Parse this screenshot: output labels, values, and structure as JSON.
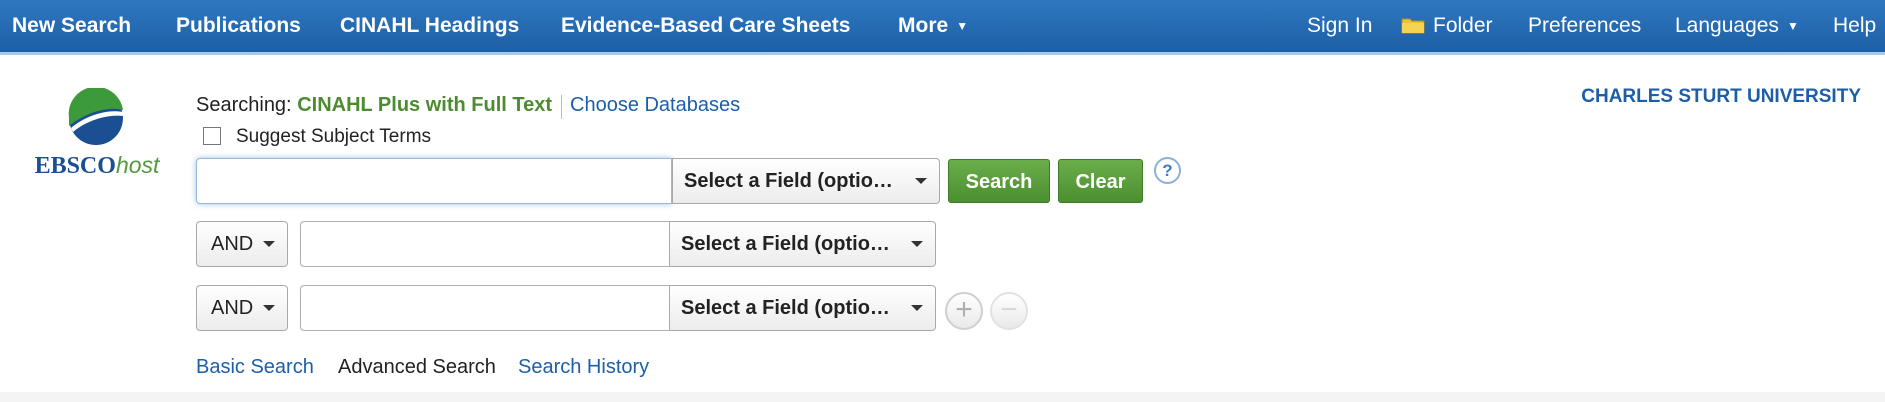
{
  "nav": {
    "new_search": "New Search",
    "publications": "Publications",
    "cinahl_headings": "CINAHL Headings",
    "care_sheets": "Evidence-Based Care Sheets",
    "more": "More",
    "sign_in": "Sign In",
    "folder": "Folder",
    "preferences": "Preferences",
    "languages": "Languages",
    "help": "Help"
  },
  "logo": {
    "ebsco": "EBSCO",
    "host": "host"
  },
  "searching": {
    "label": "Searching:",
    "database": "CINAHL Plus with Full Text",
    "choose_databases": "Choose Databases"
  },
  "suggest_subject_terms": {
    "label": "Suggest Subject Terms",
    "checked": false
  },
  "search_rows": [
    {
      "operator": "",
      "value": "",
      "field": "Select a Field (optio…"
    },
    {
      "operator": "AND",
      "value": "",
      "field": "Select a Field (optio…"
    },
    {
      "operator": "AND",
      "value": "",
      "field": "Select a Field (optio…"
    }
  ],
  "buttons": {
    "search": "Search",
    "clear": "Clear",
    "help": "?",
    "add_row": "+",
    "remove_row": "−"
  },
  "links": {
    "basic_search": "Basic Search",
    "advanced_search": "Advanced Search",
    "search_history": "Search History"
  },
  "institution": "CHARLES STURT UNIVERSITY",
  "colors": {
    "nav_bar": "#1f63aa",
    "accent_green": "#5a9e3a",
    "link_blue": "#1d5ea8"
  },
  "icons": [
    "folder-icon",
    "ebscohost-logo",
    "help-icon",
    "chevron-down-icon",
    "add-icon",
    "remove-icon"
  ]
}
